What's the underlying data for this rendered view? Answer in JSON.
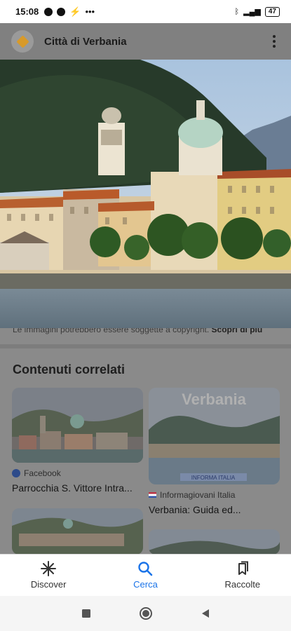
{
  "status": {
    "time": "15:08",
    "battery": "47"
  },
  "app": {
    "title": "Città di Verbania"
  },
  "disclaimer": {
    "text": "Le immagini potrebbero essere soggette a copyright.",
    "link": "Scopri di più"
  },
  "related": {
    "heading": "Contenuti correlati",
    "cards": [
      {
        "source": "Facebook",
        "title": "Parrocchia S. Vittore Intra..."
      },
      {
        "source": "Informagiovani Italia",
        "title": "Verbania: Guida ed...",
        "image_text": "Verbania",
        "watermark": "INFORMA ITALIA"
      }
    ]
  },
  "nav": {
    "discover": "Discover",
    "search": "Cerca",
    "collections": "Raccolte"
  },
  "colors": {
    "accent": "#1a73e8",
    "overlay": "#808080"
  }
}
